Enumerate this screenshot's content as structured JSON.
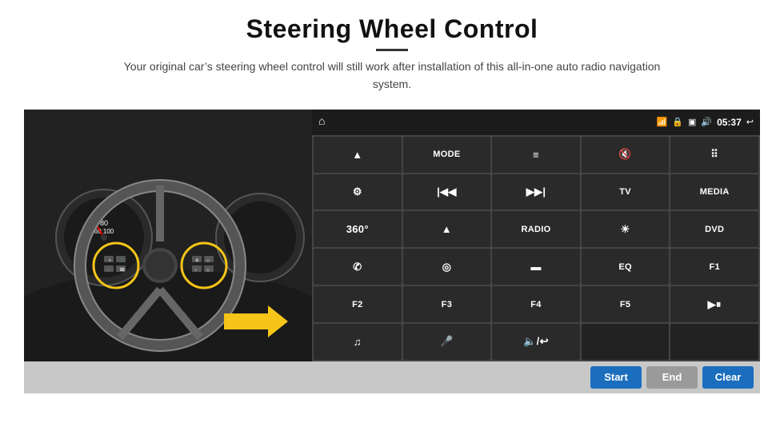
{
  "header": {
    "title": "Steering Wheel Control",
    "subtitle": "Your original car’s steering wheel control will still work after installation of this all-in-one auto radio navigation system."
  },
  "status_bar": {
    "time": "05:37",
    "icons": [
      "wifi",
      "lock",
      "sim",
      "bluetooth",
      "return"
    ]
  },
  "buttons": [
    {
      "id": "nav",
      "type": "icon",
      "symbol": "⬆",
      "col": 1,
      "row": 1
    },
    {
      "id": "mode",
      "type": "text",
      "label": "MODE",
      "col": 2,
      "row": 1
    },
    {
      "id": "list",
      "type": "icon",
      "symbol": "☰",
      "col": 3,
      "row": 1
    },
    {
      "id": "mute",
      "type": "icon",
      "symbol": "🔇",
      "col": 4,
      "row": 1
    },
    {
      "id": "apps",
      "type": "icon",
      "symbol": "⠿",
      "col": 5,
      "row": 1
    },
    {
      "id": "settings",
      "type": "icon",
      "symbol": "⚙",
      "col": 1,
      "row": 2
    },
    {
      "id": "prev",
      "type": "icon",
      "symbol": "⏮",
      "col": 2,
      "row": 2
    },
    {
      "id": "next",
      "type": "icon",
      "symbol": "⏭",
      "col": 3,
      "row": 2
    },
    {
      "id": "tv",
      "type": "text",
      "label": "TV",
      "col": 4,
      "row": 2
    },
    {
      "id": "media",
      "type": "text",
      "label": "MEDIA",
      "col": 5,
      "row": 2
    },
    {
      "id": "360cam",
      "type": "icon",
      "symbol": "360°",
      "col": 1,
      "row": 3
    },
    {
      "id": "eject",
      "type": "icon",
      "symbol": "⏏",
      "col": 2,
      "row": 3
    },
    {
      "id": "radio",
      "type": "text",
      "label": "RADIO",
      "col": 3,
      "row": 3
    },
    {
      "id": "brightness",
      "type": "icon",
      "symbol": "☀",
      "col": 4,
      "row": 3
    },
    {
      "id": "dvd",
      "type": "text",
      "label": "DVD",
      "col": 5,
      "row": 3
    },
    {
      "id": "phone",
      "type": "icon",
      "symbol": "📞",
      "col": 1,
      "row": 4
    },
    {
      "id": "navi",
      "type": "icon",
      "symbol": "🧭",
      "col": 2,
      "row": 4
    },
    {
      "id": "mirror",
      "type": "icon",
      "symbol": "▬",
      "col": 3,
      "row": 4
    },
    {
      "id": "eq",
      "type": "text",
      "label": "EQ",
      "col": 4,
      "row": 4
    },
    {
      "id": "f1",
      "type": "text",
      "label": "F1",
      "col": 5,
      "row": 4
    },
    {
      "id": "f2",
      "type": "text",
      "label": "F2",
      "col": 1,
      "row": 5
    },
    {
      "id": "f3",
      "type": "text",
      "label": "F3",
      "col": 2,
      "row": 5
    },
    {
      "id": "f4",
      "type": "text",
      "label": "F4",
      "col": 3,
      "row": 5
    },
    {
      "id": "f5",
      "type": "text",
      "label": "F5",
      "col": 4,
      "row": 5
    },
    {
      "id": "playpause",
      "type": "icon",
      "symbol": "⏯",
      "col": 5,
      "row": 5
    },
    {
      "id": "music",
      "type": "icon",
      "symbol": "♫",
      "col": 1,
      "row": 6
    },
    {
      "id": "mic",
      "type": "icon",
      "symbol": "🎤",
      "col": 2,
      "row": 6
    },
    {
      "id": "vol",
      "type": "icon",
      "symbol": "🔈/↩",
      "col": 3,
      "row": 6
    },
    {
      "id": "empty1",
      "type": "empty",
      "label": "",
      "col": 4,
      "row": 6
    },
    {
      "id": "empty2",
      "type": "empty",
      "label": "",
      "col": 5,
      "row": 6
    }
  ],
  "bottom_buttons": {
    "start": "Start",
    "end": "End",
    "clear": "Clear"
  }
}
